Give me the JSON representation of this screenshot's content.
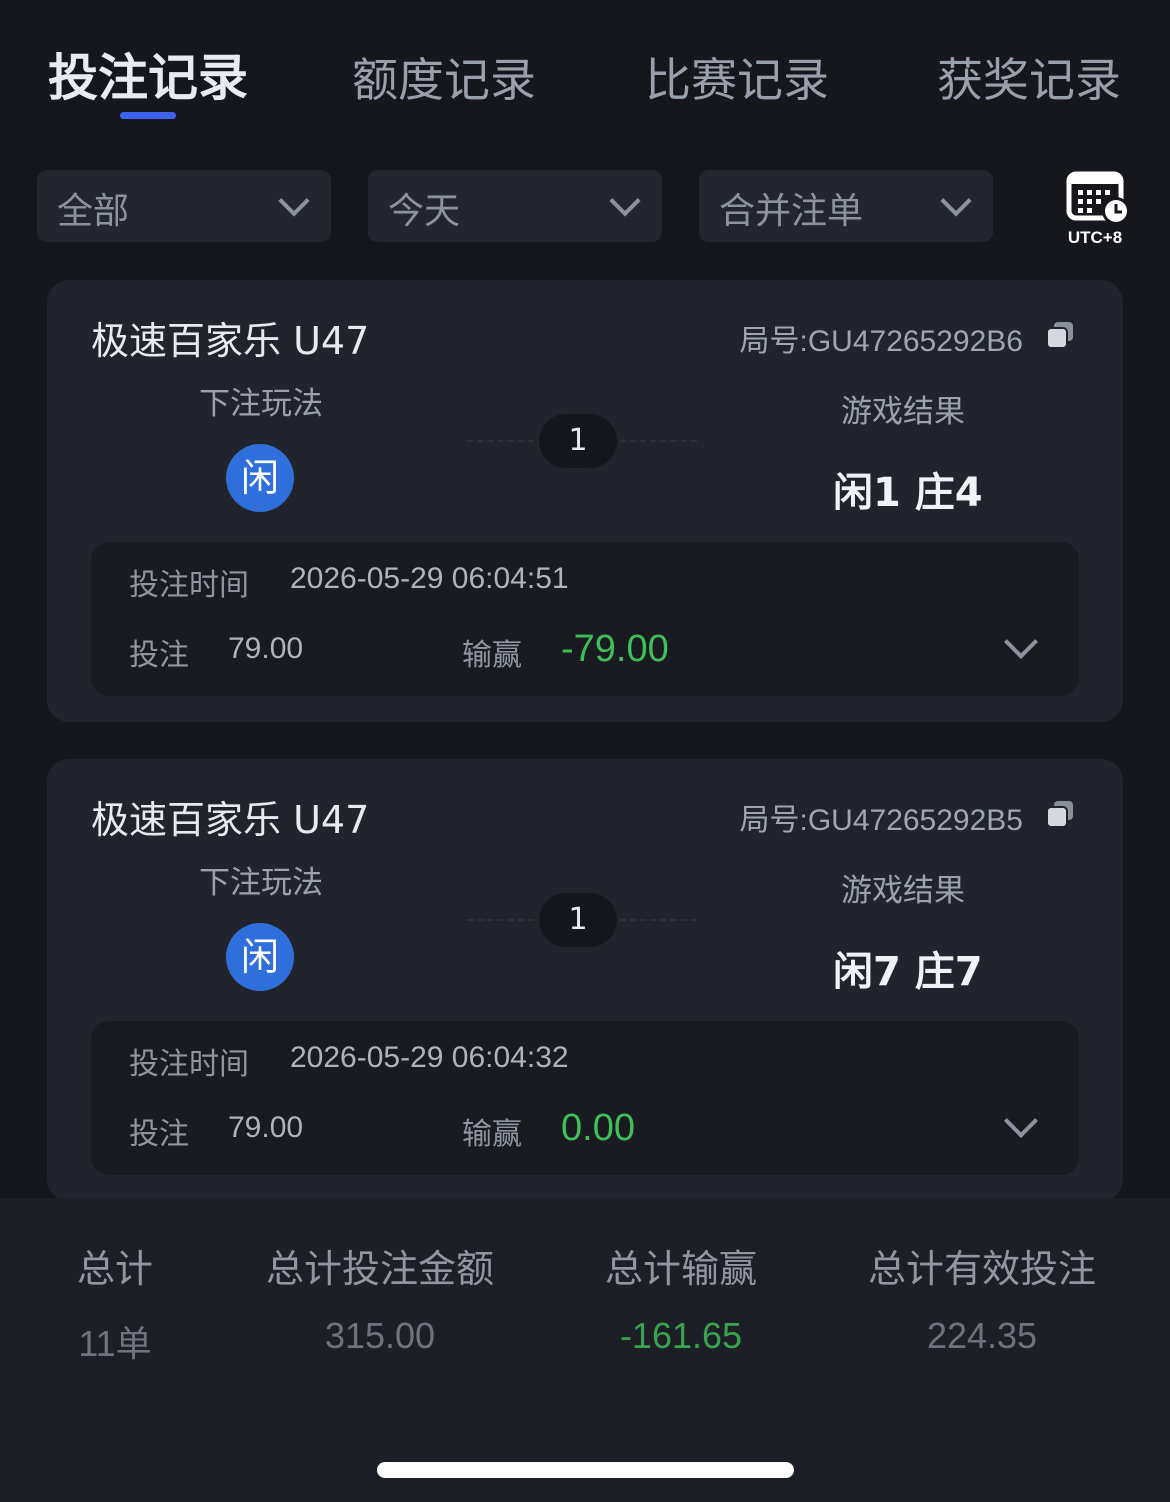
{
  "tabs": [
    {
      "label": "投注记录",
      "active": true
    },
    {
      "label": "额度记录",
      "active": false
    },
    {
      "label": "比赛记录",
      "active": false
    },
    {
      "label": "获奖记录",
      "active": false
    }
  ],
  "filters": [
    {
      "label": "全部",
      "icon": "chevron-down-icon"
    },
    {
      "label": "今天",
      "icon": "chevron-down-icon"
    },
    {
      "label": "合并注单",
      "icon": "chevron-down-icon"
    }
  ],
  "timezone": {
    "label": "UTC+8",
    "icon": "calendar-clock-icon"
  },
  "records": [
    {
      "game": "极速百家乐 U47",
      "round": "局号:GU47265292B6",
      "bet_type_label": "下注玩法",
      "bet_chip": "闲",
      "count": "1",
      "result_label": "游戏结果",
      "result": "闲1 庄4",
      "time_label": "投注时间",
      "time": "2026-05-29 06:04:51",
      "stake_label": "投注",
      "stake": "79.00",
      "winloss_label": "输赢",
      "winloss": "-79.00"
    },
    {
      "game": "极速百家乐 U47",
      "round": "局号:GU47265292B5",
      "bet_type_label": "下注玩法",
      "bet_chip": "闲",
      "count": "1",
      "result_label": "游戏结果",
      "result": "闲7 庄7",
      "time_label": "投注时间",
      "time": "2026-05-29 06:04:32",
      "stake_label": "投注",
      "stake": "79.00",
      "winloss_label": "输赢",
      "winloss": "0.00"
    }
  ],
  "summary": {
    "total_label": "总计",
    "total_value": "11单",
    "bet_amount_label": "总计投注金额",
    "bet_amount_value": "315.00",
    "winloss_label": "总计输赢",
    "winloss_value": "-161.65",
    "valid_bet_label": "总计有效投注",
    "valid_bet_value": "224.35"
  },
  "colors": {
    "background": "#15171d",
    "card": "#21242c",
    "accent": "#3d63f0",
    "chip": "#2f6fdc",
    "win_green": "#3fbf59"
  }
}
